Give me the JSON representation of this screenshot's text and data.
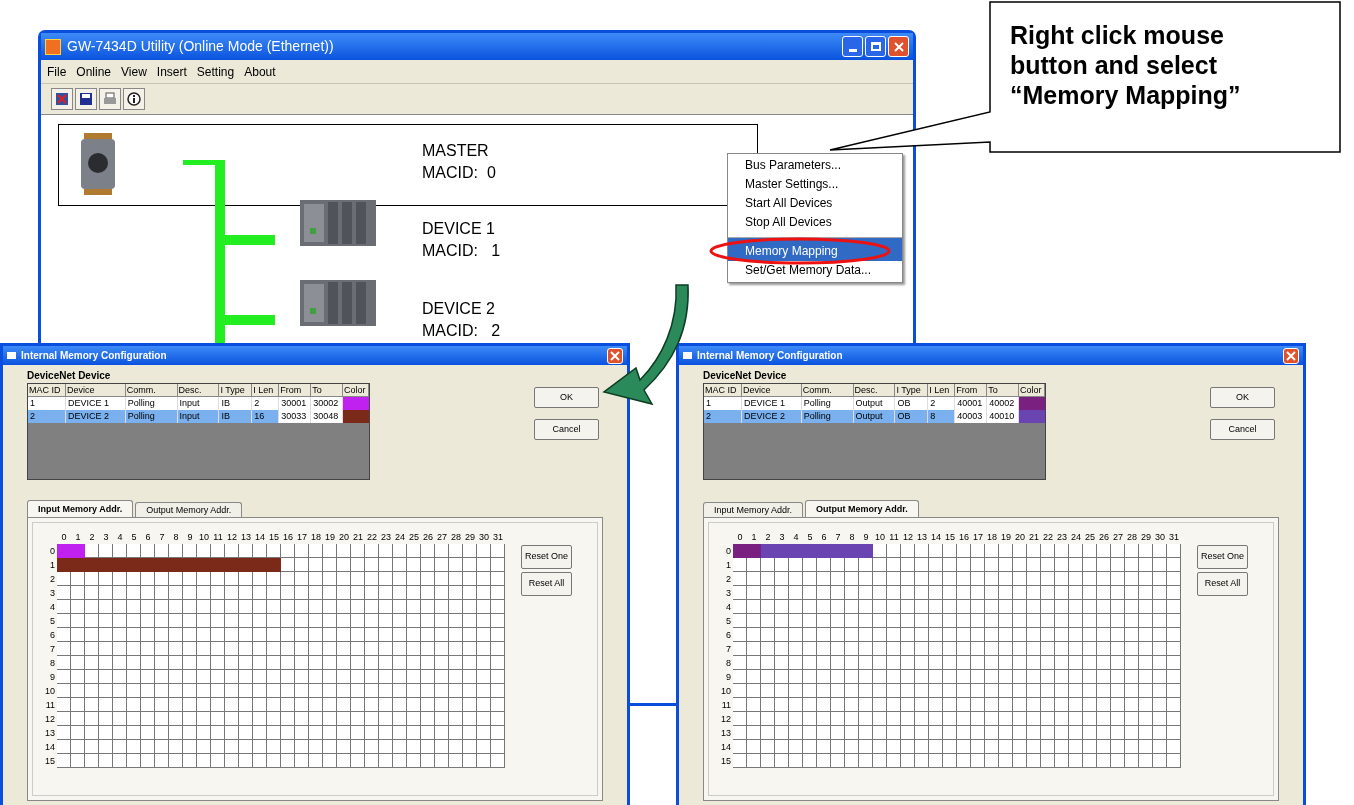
{
  "main_window": {
    "title": "GW-7434D Utility (Online Mode (Ethernet))",
    "menu": [
      "File",
      "Online",
      "View",
      "Insert",
      "Setting",
      "About"
    ],
    "nodes": [
      {
        "kind": "master",
        "name": "MASTER",
        "macid": "MACID:  0"
      },
      {
        "kind": "slave",
        "name": "DEVICE 1",
        "macid": "MACID:   1"
      },
      {
        "kind": "slave",
        "name": "DEVICE 2",
        "macid": "MACID:   2"
      }
    ],
    "context_menu": [
      {
        "label": "Bus Parameters...",
        "selected": false,
        "separator_before": false
      },
      {
        "label": "Master Settings...",
        "selected": false,
        "separator_before": false
      },
      {
        "label": "Start All Devices",
        "selected": false,
        "separator_before": false
      },
      {
        "label": "Stop All Devices",
        "selected": false,
        "separator_before": false
      },
      {
        "label": "Memory Mapping",
        "selected": true,
        "separator_before": true
      },
      {
        "label": "Set/Get Memory Data...",
        "selected": false,
        "separator_before": false
      }
    ]
  },
  "callout": {
    "lines": [
      "Right click mouse",
      "button and select",
      "“Memory Mapping”"
    ]
  },
  "dialogs": [
    {
      "title": "Internal Memory Configuration",
      "section_label": "DeviceNet Device",
      "columns": [
        "MAC ID",
        "Device",
        "Comm.",
        "Desc.",
        "I Type",
        "I Len",
        "From",
        "To",
        "Color"
      ],
      "rows": [
        {
          "cells": [
            "1",
            "DEVICE 1",
            "Polling",
            "Input",
            "IB",
            "2",
            "30001",
            "30002"
          ],
          "selected": false,
          "color": "#c020f0"
        },
        {
          "cells": [
            "2",
            "DEVICE 2",
            "Polling",
            "Input",
            "IB",
            "16",
            "30033",
            "30048"
          ],
          "selected": true,
          "color": "#7b2a1a"
        }
      ],
      "buttons": [
        "OK",
        "Cancel"
      ],
      "tabs": [
        {
          "label": "Input Memory Addr.",
          "selected": true
        },
        {
          "label": "Output Memory Addr.",
          "selected": false
        }
      ],
      "column_labels": [
        "0",
        "1",
        "2",
        "3",
        "4",
        "5",
        "6",
        "7",
        "8",
        "9",
        "10",
        "11",
        "12",
        "13",
        "14",
        "15",
        "16",
        "17",
        "18",
        "19",
        "20",
        "21",
        "22",
        "23",
        "24",
        "25",
        "26",
        "27",
        "28",
        "29",
        "30",
        "31"
      ],
      "row_labels": [
        "0",
        "1",
        "2",
        "3",
        "4",
        "5",
        "6",
        "7",
        "8",
        "9",
        "10",
        "11",
        "12",
        "13",
        "14",
        "15"
      ],
      "reset_buttons": [
        "Reset One",
        "Reset All"
      ]
    },
    {
      "title": "Internal Memory Configuration",
      "section_label": "DeviceNet Device",
      "columns": [
        "MAC ID",
        "Device",
        "Comm.",
        "Desc.",
        "I Type",
        "I Len",
        "From",
        "To",
        "Color"
      ],
      "rows": [
        {
          "cells": [
            "1",
            "DEVICE 1",
            "Polling",
            "Output",
            "OB",
            "2",
            "40001",
            "40002"
          ],
          "selected": false,
          "color": "#7a2080"
        },
        {
          "cells": [
            "2",
            "DEVICE 2",
            "Polling",
            "Output",
            "OB",
            "8",
            "40003",
            "40010"
          ],
          "selected": true,
          "color": "#6a44b0"
        }
      ],
      "buttons": [
        "OK",
        "Cancel"
      ],
      "tabs": [
        {
          "label": "Input Memory Addr.",
          "selected": false
        },
        {
          "label": "Output Memory Addr.",
          "selected": true
        }
      ],
      "column_labels": [
        "0",
        "1",
        "2",
        "3",
        "4",
        "5",
        "6",
        "7",
        "8",
        "9",
        "10",
        "11",
        "12",
        "13",
        "14",
        "15",
        "16",
        "17",
        "18",
        "19",
        "20",
        "21",
        "22",
        "23",
        "24",
        "25",
        "26",
        "27",
        "28",
        "29",
        "30",
        "31"
      ],
      "row_labels": [
        "0",
        "1",
        "2",
        "3",
        "4",
        "5",
        "6",
        "7",
        "8",
        "9",
        "10",
        "11",
        "12",
        "13",
        "14",
        "15"
      ],
      "reset_buttons": [
        "Reset One",
        "Reset All"
      ]
    }
  ]
}
